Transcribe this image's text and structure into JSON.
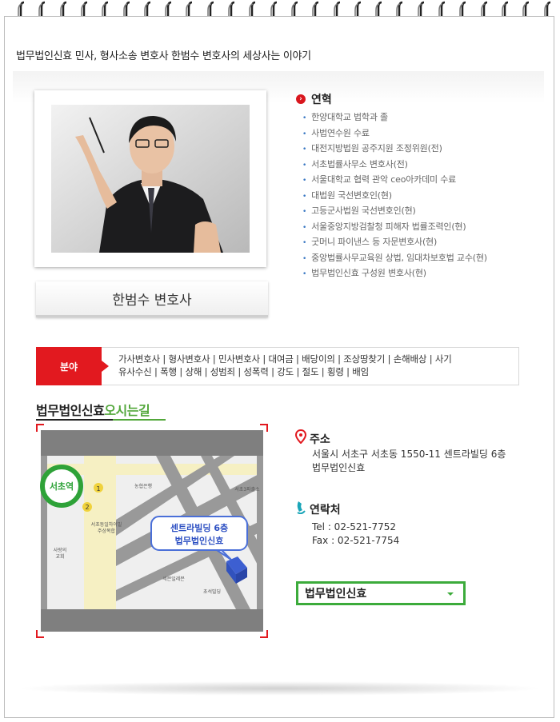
{
  "header": {
    "title": "법무법인신효 민사, 형사소송 변호사 한범수 변호사의 세상사는 이야기"
  },
  "profile": {
    "name": "한범수 변호사"
  },
  "history": {
    "title": "연혁",
    "items": [
      "한양대학교 법학과 졸",
      "사법연수원 수료",
      "대전지방법원 공주지원 조정위원(전)",
      "서초법률사무소 변호사(전)",
      "서울대학교 협력 관악 ceo아카데미 수료",
      "대법원 국선변호인(현)",
      "고등군사법원 국선변호인(현)",
      "서울중앙지방검찰청 피해자 법률조력인(현)",
      "굿머니 파이낸스 등 자문변호사(현)",
      "중앙법률사무교육원 상법, 임대차보호법 교수(현)",
      "법무법인신효 구성원 변호사(현)"
    ]
  },
  "field": {
    "badge": "분야",
    "line1": "가사변호사 | 형사변호사 | 민사변호사 | 대여금 | 배당이의 | 조상땅찾기 | 손해배상 | 사기",
    "line2": "유사수신 | 폭행 | 상해 | 성범죄 | 성폭력 | 강도 | 절도 | 횡령 | 배임"
  },
  "location": {
    "title_part1": "법무법인신효",
    "title_part2": "오시는길"
  },
  "map": {
    "station": "서초역",
    "label1": "농협은행",
    "label2": "서초3파출소",
    "label3": "서초동일하이빌",
    "label3b": "주상복합",
    "label4": "사랑의",
    "label4b": "교회",
    "label5": "세븐일레븐",
    "label6": "초석빌딩",
    "exit1": "1",
    "exit2": "2",
    "callout_line1": "센트라빌딩 6층",
    "callout_line2": "법무법인신효"
  },
  "address": {
    "title": "주소",
    "line1": "서울시 서초구 서초동 1550-11 센트라빌딩 6층",
    "line2": "법무법인신효"
  },
  "contact": {
    "title": "연락처",
    "tel": "Tel : 02-521-7752",
    "fax": "Fax : 02-521-7754"
  },
  "select": {
    "value": "법무법인신효"
  }
}
